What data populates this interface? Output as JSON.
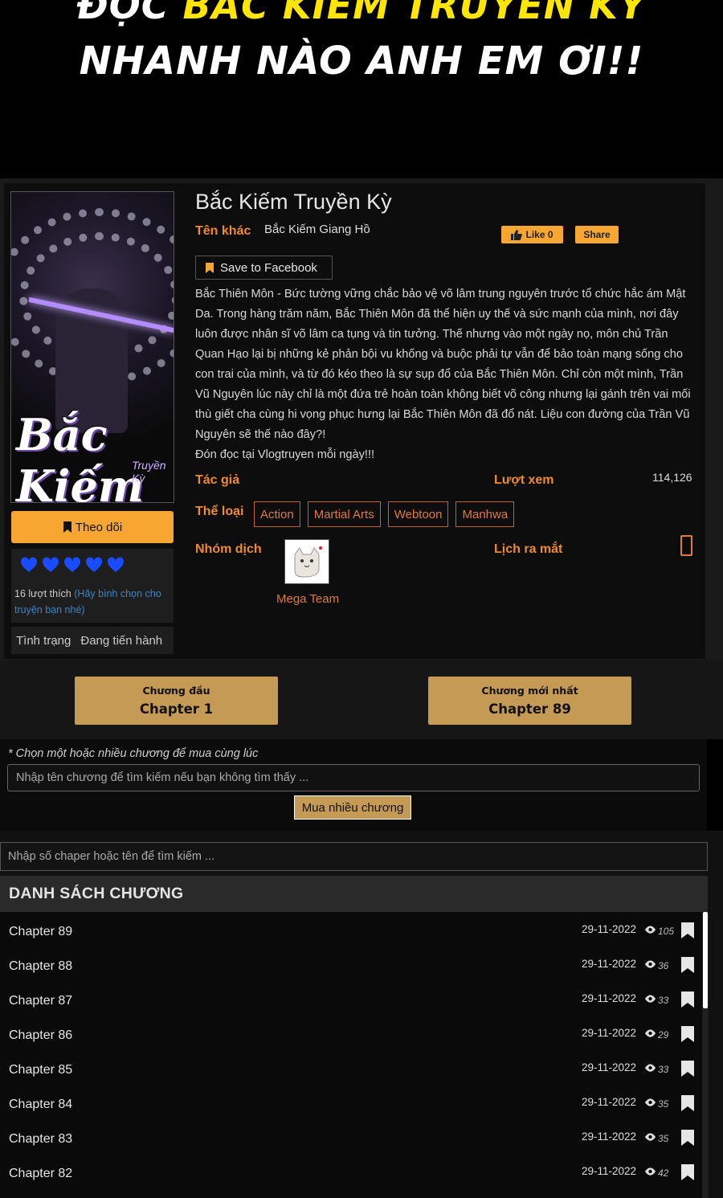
{
  "banner": {
    "line1_white": "ĐỌC",
    "line1_yellow": "BẮC KIẾM TRUYỀN KỲ",
    "line2": "NHANH NÀO ANH EM ƠI!!"
  },
  "cover": {
    "title": "Bắc Kiếm",
    "subtitle": "Truyền Kỳ"
  },
  "manga": {
    "title": "Bắc Kiếm Truyền Kỳ",
    "alt_label": "Tên khác",
    "alt_name": "Bắc Kiếm Giang Hồ",
    "like_label": "Like 0",
    "share_label": "Share",
    "save_fb_label": "Save to Facebook",
    "description": "Bắc Thiên Môn - Bức tường vững chắc bảo vệ võ lâm trung nguyên trước tổ chức hắc ám Mật Da. Trong hàng trăm năm, Bắc Thiên Môn đã thể hiện uy thế và sức mạnh của mình, nơi đây luôn được nhân sĩ võ lâm ca tụng và tin tưởng. Thế nhưng vào một ngày nọ, môn chủ Trần Quan Hạo lại bị những kẻ phản bội vu khống và buộc phải tự vẫn để bảo toàn mạng sống cho con trai của mình, và từ đó kéo theo là sự sụp đổ của Bắc Thiên Môn. Chỉ còn một mình, Trần Vũ Nguyên lúc này chỉ là một đứa trẻ hoàn toàn không biết võ công nhưng lại gánh trên vai mối thù giết cha cùng hi vọng phục hưng lại Bắc Thiên Môn đã đổ nát. Liệu con đường của Trần Vũ Nguyên sẽ thế nào đây?!",
    "promo": "Đón đọc tại Vlogtruyen mỗi ngày!!!",
    "author_label": "Tác giả",
    "views_label": "Lượt xem",
    "views_value": "114,126",
    "genre_label": "Thể loại",
    "genres": [
      "Action",
      "Martial Arts",
      "Webtoon",
      "Manhwa"
    ],
    "group_label": "Nhóm dịch",
    "group_name": "Mega Team",
    "schedule_label": "Lịch ra mắt"
  },
  "sidebar": {
    "follow_label": "Theo dõi",
    "likes_text": "16 lượt thích",
    "likes_hint": "(Hãy bình chọn cho truyện bạn nhé)",
    "status_label": "Tình trạng",
    "status_value": "Đang tiến hành",
    "heart_count": 5,
    "heart_color": "#1a4cff"
  },
  "chapter_nav": {
    "first_small": "Chương đầu",
    "first_big": "Chapter 1",
    "latest_small": "Chương mới nhất",
    "latest_big": "Chapter 89"
  },
  "buy": {
    "note": "* Chọn một hoặc nhiều chương để mua cùng lúc",
    "placeholder": "Nhập tên chương để tìm kiếm nếu bạn không tìm thấy ...",
    "button_label": "Mua nhiều chương"
  },
  "chapter_search": {
    "placeholder": "Nhập số chaper hoặc tên để tìm kiếm ..."
  },
  "chapter_list": {
    "header": "DANH SÁCH CHƯƠNG",
    "rows": [
      {
        "name": "Chapter 89",
        "date": "29-11-2022",
        "views": "105"
      },
      {
        "name": "Chapter 88",
        "date": "29-11-2022",
        "views": "36"
      },
      {
        "name": "Chapter 87",
        "date": "29-11-2022",
        "views": "33"
      },
      {
        "name": "Chapter 86",
        "date": "29-11-2022",
        "views": "29"
      },
      {
        "name": "Chapter 85",
        "date": "29-11-2022",
        "views": "33"
      },
      {
        "name": "Chapter 84",
        "date": "29-11-2022",
        "views": "35"
      },
      {
        "name": "Chapter 83",
        "date": "29-11-2022",
        "views": "35"
      },
      {
        "name": "Chapter 82",
        "date": "29-11-2022",
        "views": "42"
      }
    ]
  },
  "colors": {
    "accent_orange": "#f7a631",
    "gold_button": "#c49a55",
    "label_orange": "#f08a2c"
  }
}
